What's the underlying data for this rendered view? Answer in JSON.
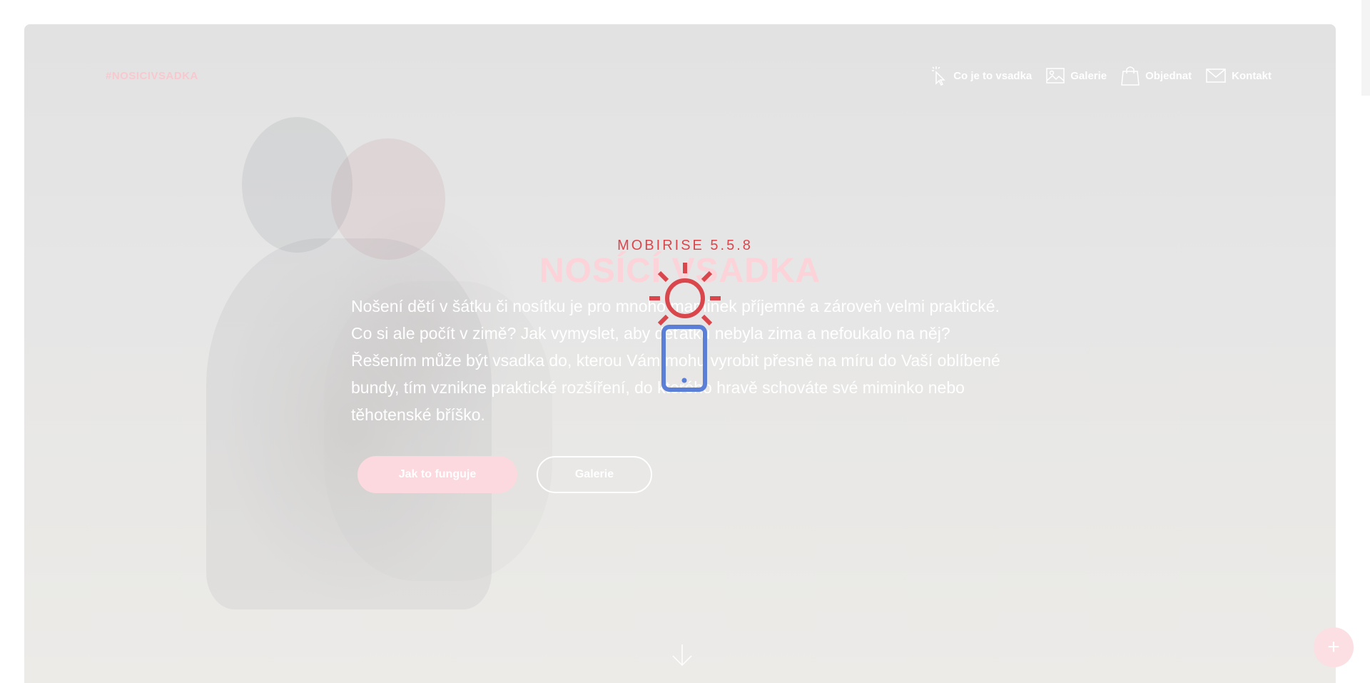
{
  "brand": {
    "logo_text": "#NOSICIVSADKA"
  },
  "nav": {
    "items": [
      {
        "label": "Co je to vsadka",
        "icon": "cursor-click-icon"
      },
      {
        "label": "Galerie",
        "icon": "image-icon"
      },
      {
        "label": "Objednat",
        "icon": "shopping-bag-icon"
      },
      {
        "label": "Kontakt",
        "icon": "envelope-icon"
      }
    ]
  },
  "hero": {
    "title": "NOSÍCÍ VSADKA",
    "text": "Nošení dětí v šátku či nosítku je pro mnoho maminek příjemné a zároveň velmi praktické. Co si ale počít v zimě? Jak vymyslet, aby děťátku nebyla zima a nefoukalo na něj? Řešením může být vsadka do, kterou Vám mohu vyrobit přesně na míru do Vaší oblíbené bundy, tím vznikne praktické rozšíření, do kterého hravě schováte své miminko nebo těhotenské bříško.",
    "primary_button": "Jak to funguje",
    "secondary_button": "Galerie"
  },
  "overlay": {
    "label": "MOBIRISE  5.5.8",
    "icon": "sun-phone-icon"
  },
  "colors": {
    "accent": "#d9474d",
    "pink": "#fcd3d9",
    "blue": "#5b7fd6"
  },
  "fab": {
    "icon": "plus-icon",
    "symbol": "+"
  }
}
